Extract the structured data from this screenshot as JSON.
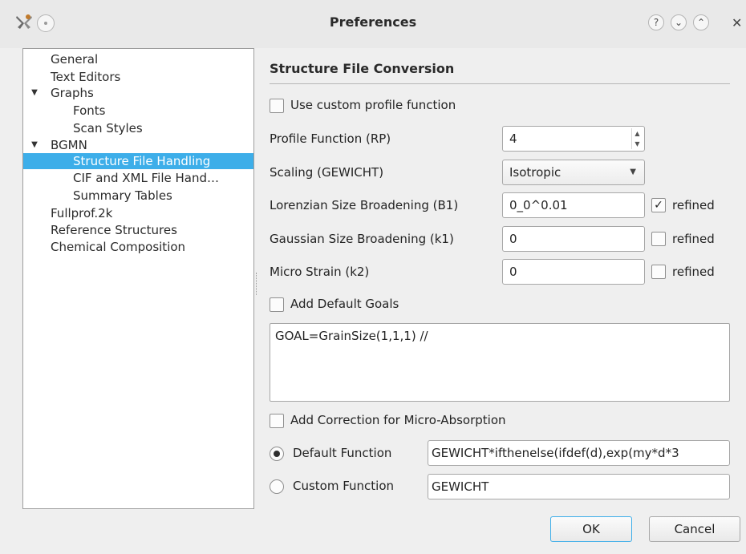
{
  "window": {
    "title": "Preferences",
    "help_glyph": "?",
    "minimize_glyph": "⌄",
    "maximize_glyph": "⌃",
    "close_glyph": "✕"
  },
  "tree": {
    "expand_glyph": "▼",
    "items": [
      {
        "label": "General"
      },
      {
        "label": "Text Editors"
      },
      {
        "label": "Graphs"
      },
      {
        "label": "Fonts"
      },
      {
        "label": "Scan Styles"
      },
      {
        "label": "BGMN"
      },
      {
        "label": "Structure File Handling"
      },
      {
        "label": "CIF and XML File Hand…"
      },
      {
        "label": "Summary Tables"
      },
      {
        "label": "Fullprof.2k"
      },
      {
        "label": "Reference Structures"
      },
      {
        "label": "Chemical Composition"
      }
    ]
  },
  "form": {
    "section_title": "Structure File Conversion",
    "use_custom_profile": {
      "label": "Use custom profile function",
      "checked": false
    },
    "profile_function": {
      "label": "Profile Function (RP)",
      "value": "4"
    },
    "scaling": {
      "label": "Scaling (GEWICHT)",
      "value": "Isotropic"
    },
    "b1": {
      "label": "Lorenzian Size Broadening (B1)",
      "value": "0_0^0.01",
      "refined_label": "refined",
      "refined": true
    },
    "k1": {
      "label": "Gaussian Size Broadening (k1)",
      "value": "0",
      "refined_label": "refined",
      "refined": false
    },
    "k2": {
      "label": "Micro Strain (k2)",
      "value": "0",
      "refined_label": "refined",
      "refined": false
    },
    "add_default_goals": {
      "label": "Add Default Goals",
      "checked": false
    },
    "goals_text": "GOAL=GrainSize(1,1,1) //",
    "micro_absorption": {
      "label": "Add Correction for Micro-Absorption",
      "checked": false
    },
    "default_function": {
      "label": "Default Function",
      "value": "GEWICHT*ifthenelse(ifdef(d),exp(my*d*3",
      "selected": true
    },
    "custom_function": {
      "label": "Custom Function",
      "value": "GEWICHT",
      "selected": false
    },
    "check_mark": "✓"
  },
  "buttons": {
    "ok": "OK",
    "cancel": "Cancel"
  },
  "colors": {
    "selection": "#3daee9",
    "window_bg": "#efefef"
  }
}
